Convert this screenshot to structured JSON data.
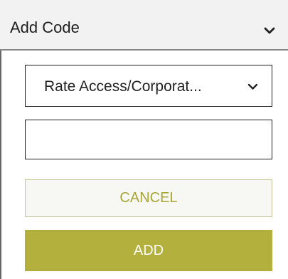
{
  "panel": {
    "title": "Add Code",
    "toggle_icon": "chevron-down-icon"
  },
  "form": {
    "code_type_select": {
      "selected": "Rate Access/Corporat...",
      "icon": "chevron-down-icon"
    },
    "code_input": {
      "value": "",
      "placeholder": ""
    },
    "cancel_label": "CANCEL",
    "add_label": "ADD"
  },
  "colors": {
    "accent": "#b3b03d",
    "accent_text": "#a8a637",
    "header_bg": "#f2f2f2"
  }
}
